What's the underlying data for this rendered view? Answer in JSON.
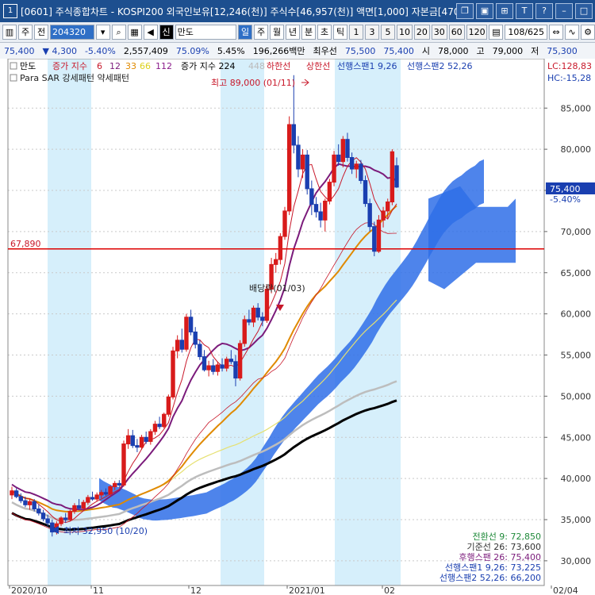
{
  "window": {
    "num": "1",
    "title": "[0601] 주식종합차트 - KOSPI200 외국인보유[12,246(천)] 주식수[46,957(천)] 액면[1,000] 자본금[470("
  },
  "toolbar": {
    "market": "주",
    "market_kind": "전",
    "code": "204320",
    "name_badge": "신",
    "name": "만도",
    "periods": [
      "일",
      "주",
      "월",
      "년",
      "분",
      "초",
      "틱"
    ],
    "active_period": "일",
    "intervals": [
      "1",
      "3",
      "5",
      "10",
      "20",
      "30",
      "60",
      "120"
    ],
    "count": "108/625"
  },
  "price": {
    "current": "75,400",
    "change": "▼ 4,300",
    "change_pct": "-5.40%",
    "volume": "2,557,409",
    "vol_ratio": "75.09%",
    "turnover": "5.45%",
    "amount": "196,266백만",
    "best_label": "최우선",
    "best_sell": "75,500",
    "best_buy": "75,400",
    "open_label": "시",
    "open": "78,000",
    "high_label": "고",
    "high": "79,000",
    "low_label": "저",
    "low": "75,300"
  },
  "legend": {
    "name": "만도",
    "vol_ma_label": "증가 지수",
    "vol_ma_values": [
      "6",
      "12",
      "33",
      "66",
      "112"
    ],
    "price_ma_label": "증가 지수 224",
    "price_ma_extra": "448",
    "lower_limit": "하한선",
    "upper_limit": "상한선",
    "span1": "선행스팬1 9,26",
    "span2": "선행스팬2 52,26",
    "sar": "Para SAR 강세패턴   약세패턴",
    "lc": "LC:128,83",
    "hc": "HC:-15,28"
  },
  "annotations": {
    "high": "최고 89,000 (01/11)",
    "low": "최저 32,950 (10/20)",
    "dividend": "배당락(01/03)",
    "hline": "67,890",
    "price_box": "75,400",
    "price_box_pct": "-5.40%"
  },
  "ichimoku_values": [
    "전환선 9: 72,850",
    "기준선 26: 73,600",
    "후행스팬 26: 75,400",
    "선행스팬1 9,26: 73,225",
    "선행스팬2 52,26: 66,200"
  ],
  "colors": {
    "title_bg": "#1d4f8f",
    "up": "#d81b1b",
    "down": "#1a3fb0",
    "cloud": "#2f6fe8",
    "shade": "#d6effb"
  },
  "chart_data": {
    "type": "candlestick",
    "y_ticks": [
      30000,
      35000,
      40000,
      45000,
      50000,
      55000,
      60000,
      65000,
      70000,
      75000,
      80000,
      85000
    ],
    "y_tick_labels": [
      "30,000",
      "35,000",
      "40,000",
      "45,000",
      "50,000",
      "55,000",
      "60,000",
      "65,000",
      "70,000",
      "75,000",
      "80,000",
      "85,000"
    ],
    "ylim": [
      27000,
      91000
    ],
    "x_labels": [
      "2020/10",
      "11",
      "12",
      "2021/01",
      "02",
      "02/04"
    ],
    "last_price": 75400,
    "horizontal_line": 67890,
    "candles": [
      [
        38000,
        39000,
        37500,
        38500
      ],
      [
        38500,
        38800,
        37600,
        37800
      ],
      [
        37800,
        38200,
        37000,
        37300
      ],
      [
        37300,
        37800,
        36500,
        36800
      ],
      [
        36800,
        37500,
        36200,
        37200
      ],
      [
        37200,
        37500,
        36000,
        36300
      ],
      [
        36300,
        36800,
        35500,
        35800
      ],
      [
        35800,
        36200,
        34800,
        35100
      ],
      [
        35100,
        35600,
        34200,
        34600
      ],
      [
        34600,
        35000,
        32950,
        33500
      ],
      [
        33500,
        34800,
        33200,
        34500
      ],
      [
        34500,
        35400,
        34200,
        35200
      ],
      [
        35200,
        35800,
        34600,
        35000
      ],
      [
        35000,
        36200,
        34800,
        36000
      ],
      [
        36000,
        37000,
        35700,
        36700
      ],
      [
        36700,
        37500,
        36200,
        36400
      ],
      [
        36400,
        37400,
        36200,
        37100
      ],
      [
        37100,
        38000,
        36800,
        37700
      ],
      [
        37700,
        38400,
        37300,
        37500
      ],
      [
        37500,
        38300,
        37200,
        38000
      ],
      [
        38000,
        38600,
        37600,
        38300
      ],
      [
        38300,
        38800,
        37900,
        38100
      ],
      [
        38100,
        39200,
        37800,
        39000
      ],
      [
        39000,
        39700,
        38600,
        39400
      ],
      [
        39400,
        39800,
        38900,
        39200
      ],
      [
        39200,
        44600,
        39000,
        44200
      ],
      [
        44200,
        46000,
        43600,
        45200
      ],
      [
        45200,
        45900,
        43700,
        44000
      ],
      [
        44000,
        44800,
        43200,
        43800
      ],
      [
        43800,
        45300,
        43500,
        45000
      ],
      [
        45000,
        45700,
        44200,
        44500
      ],
      [
        44500,
        46000,
        44100,
        45700
      ],
      [
        45700,
        47000,
        45300,
        46600
      ],
      [
        46600,
        47500,
        46000,
        46300
      ],
      [
        46300,
        48000,
        46100,
        47800
      ],
      [
        47800,
        50200,
        47500,
        49900
      ],
      [
        49900,
        56000,
        49600,
        55500
      ],
      [
        55500,
        57400,
        54600,
        56800
      ],
      [
        56800,
        58200,
        55300,
        55700
      ],
      [
        55700,
        60000,
        55400,
        59600
      ],
      [
        59600,
        60500,
        57400,
        57800
      ],
      [
        57800,
        58400,
        55800,
        56300
      ],
      [
        56300,
        56800,
        54400,
        54800
      ],
      [
        54800,
        55600,
        53000,
        53200
      ],
      [
        53200,
        54300,
        52400,
        53700
      ],
      [
        53700,
        54500,
        52600,
        53000
      ],
      [
        53000,
        54200,
        52500,
        53800
      ],
      [
        53800,
        54600,
        53000,
        53400
      ],
      [
        53400,
        54800,
        53000,
        54500
      ],
      [
        54500,
        55600,
        53900,
        54200
      ],
      [
        54200,
        55000,
        51200,
        52200
      ],
      [
        52200,
        56800,
        51900,
        56400
      ],
      [
        56400,
        59800,
        56000,
        59300
      ],
      [
        59300,
        60500,
        58600,
        59000
      ],
      [
        59000,
        61000,
        58400,
        60700
      ],
      [
        60700,
        61300,
        59200,
        59600
      ],
      [
        59600,
        60200,
        58500,
        59200
      ],
      [
        59200,
        63500,
        58900,
        63000
      ],
      [
        63000,
        66800,
        62500,
        66000
      ],
      [
        66000,
        67400,
        65000,
        66600
      ],
      [
        66600,
        69800,
        66000,
        69400
      ],
      [
        69400,
        73000,
        69000,
        72500
      ],
      [
        72500,
        84000,
        72000,
        83000
      ],
      [
        83000,
        89000,
        79500,
        80500
      ],
      [
        80500,
        81600,
        76600,
        77600
      ],
      [
        77600,
        80000,
        76500,
        79300
      ],
      [
        79300,
        79900,
        74500,
        75200
      ],
      [
        75200,
        76200,
        72000,
        73300
      ],
      [
        73300,
        74200,
        71700,
        72400
      ],
      [
        72400,
        73500,
        70500,
        71400
      ],
      [
        71400,
        74000,
        70000,
        73700
      ],
      [
        73700,
        76400,
        73300,
        76000
      ],
      [
        76000,
        79800,
        75500,
        79300
      ],
      [
        79300,
        80600,
        78000,
        78500
      ],
      [
        78500,
        81600,
        77800,
        81200
      ],
      [
        81200,
        82000,
        78500,
        79000
      ],
      [
        79000,
        79600,
        77000,
        77600
      ],
      [
        77600,
        78600,
        76500,
        78200
      ],
      [
        78200,
        78700,
        75800,
        76200
      ],
      [
        76200,
        76800,
        73000,
        73400
      ],
      [
        73400,
        74000,
        70000,
        70600
      ],
      [
        70600,
        71200,
        67000,
        67600
      ],
      [
        67600,
        72000,
        67400,
        71400
      ],
      [
        71400,
        73000,
        70500,
        72500
      ],
      [
        72500,
        74000,
        71500,
        73600
      ],
      [
        73600,
        80000,
        73200,
        79700
      ],
      [
        78000,
        79000,
        75300,
        75400
      ]
    ]
  }
}
